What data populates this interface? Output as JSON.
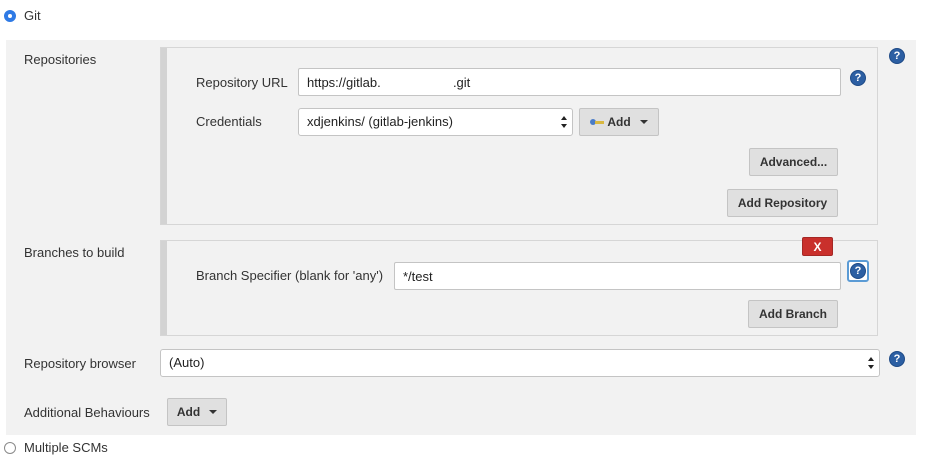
{
  "scm_options": {
    "git": {
      "label": "Git",
      "selected": true
    },
    "multiple": {
      "label": "Multiple SCMs",
      "selected": false
    }
  },
  "repositories": {
    "label": "Repositories",
    "url_label": "Repository URL",
    "url_value": "https://gitlab.                    .git",
    "credentials_label": "Credentials",
    "credentials_value": "xdjenkins/          (gitlab-jenkins)",
    "add_label": "Add",
    "advanced_label": "Advanced...",
    "add_repository_label": "Add Repository"
  },
  "branches": {
    "label": "Branches to build",
    "delete_label": "X",
    "specifier_label": "Branch Specifier (blank for 'any')",
    "specifier_value": "*/test",
    "add_branch_label": "Add Branch"
  },
  "browser": {
    "label": "Repository browser",
    "value": "(Auto)"
  },
  "behaviours": {
    "label": "Additional Behaviours",
    "add_label": "Add"
  },
  "help_glyph": "?",
  "colors": {
    "section_bg": "#f2f2f2",
    "help": "#2c5fa3",
    "delete": "#c9302c",
    "radio_selected": "#2f7ae5"
  }
}
